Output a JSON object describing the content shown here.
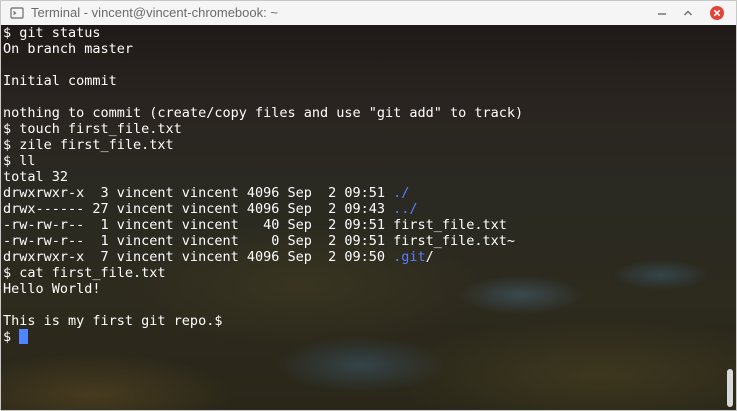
{
  "window": {
    "title": "Terminal - vincent@vincent-chromebook: ~",
    "icon": "terminal-icon",
    "buttons": [
      "minimize-icon",
      "maximize-icon",
      "close-icon"
    ],
    "close_color": "#e0443a"
  },
  "terminal": {
    "lines": [
      [
        {
          "t": "$ git status"
        }
      ],
      [
        {
          "t": "On branch master"
        }
      ],
      [
        {
          "t": ""
        }
      ],
      [
        {
          "t": "Initial commit"
        }
      ],
      [
        {
          "t": ""
        }
      ],
      [
        {
          "t": "nothing to commit (create/copy files and use \"git add\" to track)"
        }
      ],
      [
        {
          "t": "$ touch first_file.txt"
        }
      ],
      [
        {
          "t": "$ zile first_file.txt"
        }
      ],
      [
        {
          "t": "$ ll"
        }
      ],
      [
        {
          "t": "total 32"
        }
      ],
      [
        {
          "t": "drwxrwxr-x  3 vincent vincent 4096 Sep  2 09:51 "
        },
        {
          "t": "./",
          "dir": true
        }
      ],
      [
        {
          "t": "drwx------ 27 vincent vincent 4096 Sep  2 09:43 "
        },
        {
          "t": "../",
          "dir": true
        }
      ],
      [
        {
          "t": "-rw-rw-r--  1 vincent vincent   40 Sep  2 09:51 first_file.txt"
        }
      ],
      [
        {
          "t": "-rw-rw-r--  1 vincent vincent    0 Sep  2 09:51 first_file.txt~"
        }
      ],
      [
        {
          "t": "drwxrwxr-x  7 vincent vincent 4096 Sep  2 09:50 "
        },
        {
          "t": ".git",
          "dir": true
        },
        {
          "t": "/"
        }
      ],
      [
        {
          "t": "$ cat first_file.txt"
        }
      ],
      [
        {
          "t": "Hello World!"
        }
      ],
      [
        {
          "t": ""
        }
      ],
      [
        {
          "t": "This is my first git repo.$"
        }
      ]
    ],
    "prompt": "$ ",
    "dir_color": "#5c7cff",
    "cursor_color": "#4f86ff"
  }
}
